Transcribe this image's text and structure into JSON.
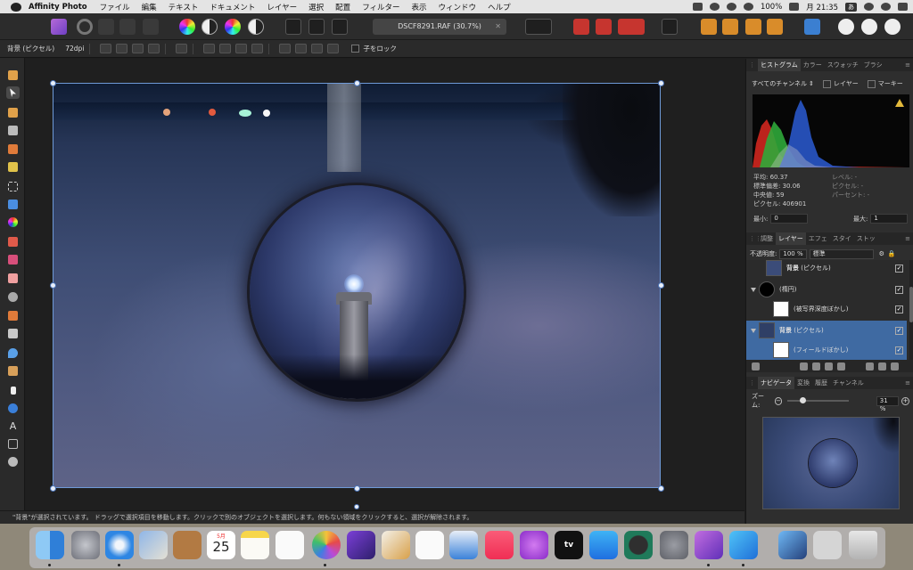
{
  "menubar": {
    "app_name": "Affinity Photo",
    "menus": [
      "ファイル",
      "編集",
      "テキスト",
      "ドキュメント",
      "レイヤー",
      "選択",
      "配置",
      "フィルター",
      "表示",
      "ウィンドウ",
      "ヘルプ"
    ],
    "battery": "100%",
    "clock": "月 21:35",
    "input_badge": "あ"
  },
  "toolbar": {
    "document_title": "DSCF8291.RAF (30.7%)"
  },
  "context": {
    "layer_label": "背景 (ピクセル)",
    "dpi": "72dpi",
    "lock_children": "子をロック"
  },
  "status": {
    "message": "\"背景\"が選択されています。 ドラッグで選択項目を移動します。クリックで別のオブジェクトを選択します。何もない領域をクリックすると、選択が解除されます。"
  },
  "histogram_panel": {
    "tabs": [
      "ヒストグラム",
      "カラー",
      "スウォッチ",
      "ブラシ"
    ],
    "channel": "すべてのチャンネル",
    "layer_label": "レイヤー",
    "marquee_label": "マーキー",
    "mean": "平均: 60.37",
    "std_dev": "標準偏差: 30.06",
    "median": "中央値: 59",
    "pixels": "ピクセル: 406901",
    "level": "レベル: -",
    "pixel_right": "ピクセル: -",
    "percentile": "パーセント: -",
    "min_label": "最小:",
    "min_value": "0",
    "max_label": "最大:",
    "max_value": "1"
  },
  "layers_panel": {
    "tabs": [
      "調整",
      "レイヤー",
      "エフェ",
      "スタイ",
      "ストッ"
    ],
    "opacity_label": "不透明度:",
    "opacity_value": "100 %",
    "blend_mode": "標準",
    "layers": [
      {
        "name": "背景",
        "type": "(ピクセル)"
      },
      {
        "name": "",
        "type": "(楕円)"
      },
      {
        "name": "",
        "type": "(被写界深度ぼかし)"
      },
      {
        "name": "背景",
        "type": "(ピクセル)"
      },
      {
        "name": "",
        "type": "(フィールドぼかし)"
      }
    ]
  },
  "navigator_panel": {
    "tabs": [
      "ナビゲータ",
      "変換",
      "履歴",
      "チャンネル"
    ],
    "zoom_label": "ズーム:",
    "zoom_value": "31 %"
  },
  "dock": {
    "calendar_month": "5月",
    "calendar_day": "25",
    "tv_label": "tv"
  },
  "colors": {
    "accent": "#3f6aa2",
    "selection": "#6f9ad8",
    "panel": "#2e2e2e",
    "warning": "#e2b93b"
  }
}
